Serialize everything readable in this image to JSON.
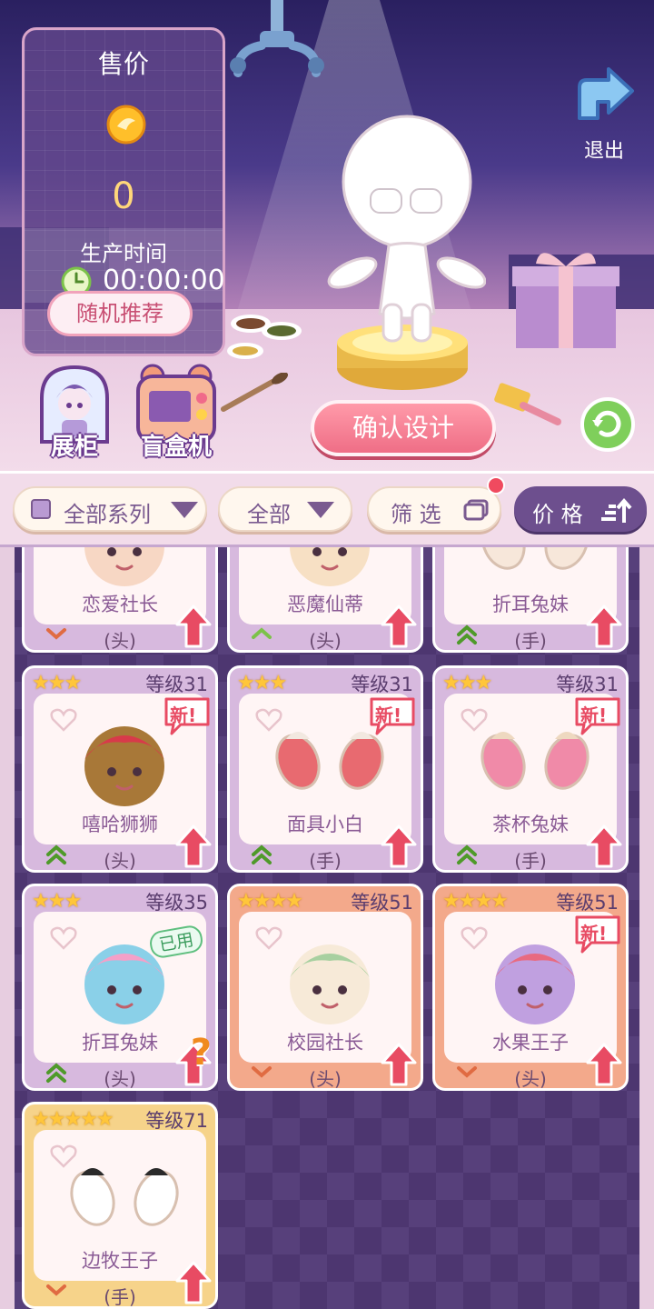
{
  "price_panel": {
    "title": "售价",
    "price": "0",
    "time_label": "生产时间",
    "time_value": "00:00:00",
    "random_button": "随机推荐"
  },
  "exit": {
    "label": "退出"
  },
  "side_buttons": {
    "showcase": "展柜",
    "blindbox": "盲盒机"
  },
  "confirm_button": "确认设计",
  "filters": {
    "series": "全部系列",
    "category": "全部",
    "filter": "筛 选",
    "sort": "价 格"
  },
  "cards": [
    {
      "name": "恋爱社长",
      "slot": "(头)",
      "chevron": "down",
      "color": "purple"
    },
    {
      "name": "恶魔仙蒂",
      "slot": "(头)",
      "chevron": "up",
      "color": "purple"
    },
    {
      "name": "折耳兔妹",
      "slot": "(手)",
      "chevron": "double-up",
      "color": "purple"
    },
    {
      "stars": "★★★",
      "level": "等级31",
      "name": "嘻哈狮狮",
      "slot": "(头)",
      "badge": "新!",
      "chevron": "double-up",
      "color": "purple"
    },
    {
      "stars": "★★★",
      "level": "等级31",
      "name": "面具小白",
      "slot": "(手)",
      "badge": "新!",
      "chevron": "double-up",
      "color": "purple"
    },
    {
      "stars": "★★★",
      "level": "等级31",
      "name": "茶杯兔妹",
      "slot": "(手)",
      "badge": "新!",
      "chevron": "double-up",
      "color": "purple"
    },
    {
      "stars": "★★★",
      "level": "等级35",
      "name": "折耳兔妹",
      "slot": "(头)",
      "badge": "已用",
      "chevron": "double-up",
      "color": "purple"
    },
    {
      "stars": "★★★★",
      "level": "等级51",
      "name": "校园社长",
      "slot": "(头)",
      "chevron": "down",
      "color": "orange"
    },
    {
      "stars": "★★★★",
      "level": "等级51",
      "name": "水果王子",
      "slot": "(头)",
      "badge": "新!",
      "chevron": "down",
      "color": "orange"
    },
    {
      "stars": "★★★★★",
      "level": "等级71",
      "name": "边牧王子",
      "slot": "(手)",
      "chevron": "down",
      "color": "gold"
    }
  ],
  "colors": {
    "accent_pink": "#ef6e86",
    "panel_purple": "#6d4f8e",
    "star_gold": "#ffc63a",
    "upgrade_red": "#e84b63"
  },
  "icons": [
    "claw-icon",
    "coin-icon",
    "clock-icon",
    "exit-arrow-icon",
    "refresh-icon",
    "upgrade-arrow-icon",
    "heart-icon",
    "sort-icon",
    "filter-icon"
  ]
}
